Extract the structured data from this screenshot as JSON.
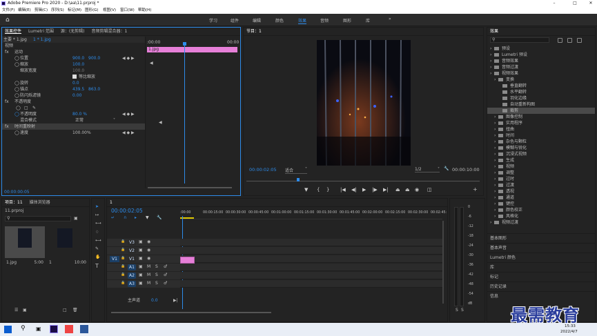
{
  "window": {
    "title": "Adobe Premiere Pro 2020 - D:\\aa\\11.prproj *"
  },
  "menu": [
    "文件(F)",
    "编辑(E)",
    "剪辑(C)",
    "序列(S)",
    "标记(M)",
    "图形(G)",
    "视图(V)",
    "窗口(W)",
    "帮助(H)"
  ],
  "workspaces": [
    "学习",
    "组件",
    "编辑",
    "颜色",
    "效果",
    "音频",
    "图形",
    "库"
  ],
  "effect_controls": {
    "tabs": [
      "效果控件",
      "Lumetri 范围",
      "源：(无剪辑)",
      "音频剪辑混合器：1"
    ],
    "source": "主要 * 1.jpg",
    "clip": "1 * 1.jpg",
    "section_video": "视频",
    "motion": "运动",
    "props": [
      {
        "name": "位置",
        "v1": "900.0",
        "v2": "900.0"
      },
      {
        "name": "缩放",
        "v1": "100.0",
        "v2": ""
      },
      {
        "name": "缩放宽度",
        "v1": "100.0",
        "v2": ""
      },
      {
        "name": "等比缩放",
        "v1": "",
        "v2": ""
      },
      {
        "name": "旋转",
        "v1": "0.0",
        "v2": ""
      },
      {
        "name": "锚点",
        "v1": "439.5",
        "v2": "863.0"
      },
      {
        "name": "防闪烁滤镜",
        "v1": "0.00",
        "v2": ""
      }
    ],
    "opacity_label": "不透明度",
    "opacity_value": "80.0 %",
    "blend_label": "混合模式",
    "blend_value": "正常",
    "time_remap": "时间重映射",
    "speed_label": "速度",
    "speed_value": "100.00%",
    "timecode": "00:00:00:05",
    "ruler_start": ":00:00",
    "ruler_end": "00:00",
    "clip_name": "1.jpg"
  },
  "program": {
    "tab": "节目：1",
    "timecode": "00:00:02:05",
    "fit": "适合",
    "resolution": "1/2",
    "duration": "00:00:10:00"
  },
  "effects": {
    "title": "效果",
    "tree": [
      {
        "label": "预设",
        "level": 0
      },
      {
        "label": "Lumetri 预设",
        "level": 0
      },
      {
        "label": "音频效果",
        "level": 0
      },
      {
        "label": "音频过渡",
        "level": 0
      },
      {
        "label": "视频效果",
        "level": 0
      },
      {
        "label": "变换",
        "level": 1
      },
      {
        "label": "垂直翻转",
        "level": 2
      },
      {
        "label": "水平翻转",
        "level": 2
      },
      {
        "label": "羽化边缘",
        "level": 2
      },
      {
        "label": "自动重新构图",
        "level": 2
      },
      {
        "label": "裁剪",
        "level": 2,
        "selected": true
      },
      {
        "label": "图像控制",
        "level": 1
      },
      {
        "label": "实用程序",
        "level": 1
      },
      {
        "label": "扭曲",
        "level": 1
      },
      {
        "label": "时间",
        "level": 1
      },
      {
        "label": "杂色与颗粒",
        "level": 1
      },
      {
        "label": "模糊与锐化",
        "level": 1
      },
      {
        "label": "沉浸式视频",
        "level": 1
      },
      {
        "label": "生成",
        "level": 1
      },
      {
        "label": "视频",
        "level": 1
      },
      {
        "label": "调整",
        "level": 1
      },
      {
        "label": "过时",
        "level": 1
      },
      {
        "label": "过渡",
        "level": 1
      },
      {
        "label": "透视",
        "level": 1
      },
      {
        "label": "通道",
        "level": 1
      },
      {
        "label": "键控",
        "level": 1
      },
      {
        "label": "颜色校正",
        "level": 1
      },
      {
        "label": "风格化",
        "level": 1
      },
      {
        "label": "视频过渡",
        "level": 0
      }
    ],
    "panels": [
      "基本图形",
      "基本声音",
      "Lumetri 颜色",
      "库",
      "标记",
      "历史记录",
      "信息"
    ]
  },
  "project": {
    "tabs": [
      "项目：11",
      "媒体浏览器"
    ],
    "file": "11.prproj",
    "items": [
      {
        "name": "1.jpg",
        "dur": "5:00"
      },
      {
        "name": "1",
        "dur": "10:00"
      }
    ]
  },
  "timeline": {
    "tab": "1",
    "timecode": "00:00:02:05",
    "ruler": [
      ":00:00",
      "00:00:15:00",
      "00:00:30:00",
      "00:00:45:00",
      "00:01:00:00",
      "00:01:15:00",
      "00:01:30:00",
      "00:01:45:00",
      "00:02:00:00",
      "00:02:15:00",
      "00:02:30:00",
      "00:02:45:"
    ],
    "tracks": [
      {
        "name": "V3",
        "kind": "v"
      },
      {
        "name": "V2",
        "kind": "v"
      },
      {
        "name": "V1",
        "kind": "v",
        "src": "V1"
      },
      {
        "name": "A1",
        "kind": "a"
      },
      {
        "name": "A2",
        "kind": "a"
      },
      {
        "name": "A3",
        "kind": "a"
      }
    ],
    "master": "主声道",
    "master_val": "0.0"
  },
  "meter": {
    "ticks": [
      "0",
      "-6",
      "-12",
      "-18",
      "-24",
      "-30",
      "-36",
      "-42",
      "-48",
      "-54",
      "dB"
    ],
    "labels": [
      "S",
      "S"
    ]
  },
  "watermark": "最需教育",
  "taskbar": {
    "time": "15:33",
    "date": "2022/4/7"
  }
}
